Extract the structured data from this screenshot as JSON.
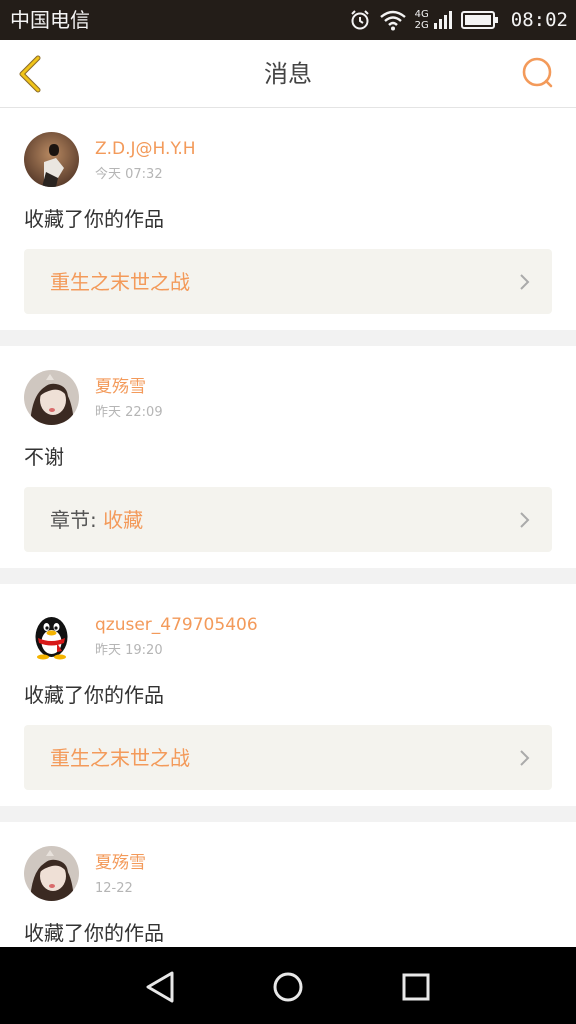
{
  "status_bar": {
    "carrier": "中国电信",
    "net_top": "4G",
    "net_bottom": "2G",
    "time": "08:02",
    "icons": [
      "alarm-icon",
      "wifi-icon",
      "signal-icon",
      "battery-icon"
    ]
  },
  "header": {
    "title": "消息",
    "back_icon": "chevron-left-icon",
    "search_icon": "search-icon",
    "accent": "#f39a5a"
  },
  "messages": [
    {
      "username": "Z.D.J@H.Y.H",
      "time": "今天  07:32",
      "text": "收藏了你的作品",
      "link_prefix": "",
      "link_text": "重生之末世之战",
      "avatar": "avatar-photo-person"
    },
    {
      "username": "夏殇雪",
      "time": "昨天  22:09",
      "text": "不谢",
      "link_prefix": "章节: ",
      "link_text": "收藏",
      "avatar": "avatar-photo-girl"
    },
    {
      "username": "qzuser_479705406",
      "time": "昨天  19:20",
      "text": "收藏了你的作品",
      "link_prefix": "",
      "link_text": "重生之末世之战",
      "avatar": "avatar-qq-penguin"
    },
    {
      "username": "夏殇雪",
      "time": "12-22",
      "text": "收藏了你的作品",
      "link_prefix": "",
      "link_text": "",
      "avatar": "avatar-photo-girl"
    }
  ],
  "nav_bar": {
    "icons": [
      "back-triangle-icon",
      "home-circle-icon",
      "recents-square-icon"
    ]
  }
}
